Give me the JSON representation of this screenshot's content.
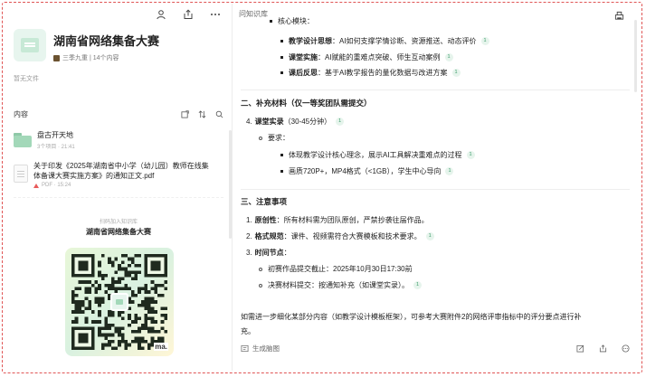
{
  "left": {
    "kb_title": "湖南省网络集备大赛",
    "kb_meta": "三季九重 | 14个内容",
    "kb_desc": "暂无文件",
    "content_label": "内容",
    "folder": {
      "name": "盘古开天地",
      "sub": "3个项目 · 21:41"
    },
    "file": {
      "name": "关于印发《2025年湖南省中小学（幼儿园）教师在线集体备课大赛实施方案》的通知正文.pdf",
      "sub": "PDF · 15:24"
    },
    "scan_hint": "扫码加入知识库",
    "scan_name": "湖南省网络集备大赛",
    "qr_suffix": "ma."
  },
  "right": {
    "title": "问知识库",
    "top_cut": "核心模块：",
    "bullets_a": [
      {
        "bold": "教学设计思想",
        "text": "：AI如何支撑学情诊断、资源推送、动态评价",
        "badge": "1"
      },
      {
        "bold": "课堂实施",
        "text": "：AI赋能的重难点突破、师生互动案例",
        "badge": "1"
      },
      {
        "bold": "课后反思",
        "text": "：基于AI教学报告的量化数据与改进方案",
        "badge": "1"
      }
    ],
    "section2": "二、补充材料（仅一等奖团队需提交）",
    "item4": {
      "num": "4.",
      "bold": "课堂实录",
      "text": "（30-45分钟）",
      "badge": "1"
    },
    "req_label": "要求：",
    "bullets_b": [
      {
        "text": "体现教学设计核心理念，展示AI工具解决重难点的过程",
        "badge": "1"
      },
      {
        "text": "画质720P+，MP4格式（<1GB），学生中心导向",
        "badge": "1"
      }
    ],
    "section3": "三、注意事项",
    "notes": [
      {
        "num": "1.",
        "bold": "原创性",
        "text": "：所有材料需为团队原创，严禁抄袭往届作品。",
        "badge": ""
      },
      {
        "num": "2.",
        "bold": "格式规范",
        "text": "：课件、视频需符合大赛模板和技术要求。",
        "badge": "1"
      },
      {
        "num": "3.",
        "bold": "时间节点",
        "text": "：",
        "badge": ""
      }
    ],
    "time_points": [
      {
        "text": "初赛作品提交截止：2025年10月30日17:30前",
        "badge": ""
      },
      {
        "text": "决赛材料提交：按通知补充（如课堂实录）。",
        "badge": "1"
      }
    ],
    "footnote_1": "如需进一步细化某部分内容（如教学设计模板框架），可参考大赛附件2的网络评审指标中的评分要点进行补",
    "footnote_2": "充。",
    "gen_map": "生成脑图"
  }
}
